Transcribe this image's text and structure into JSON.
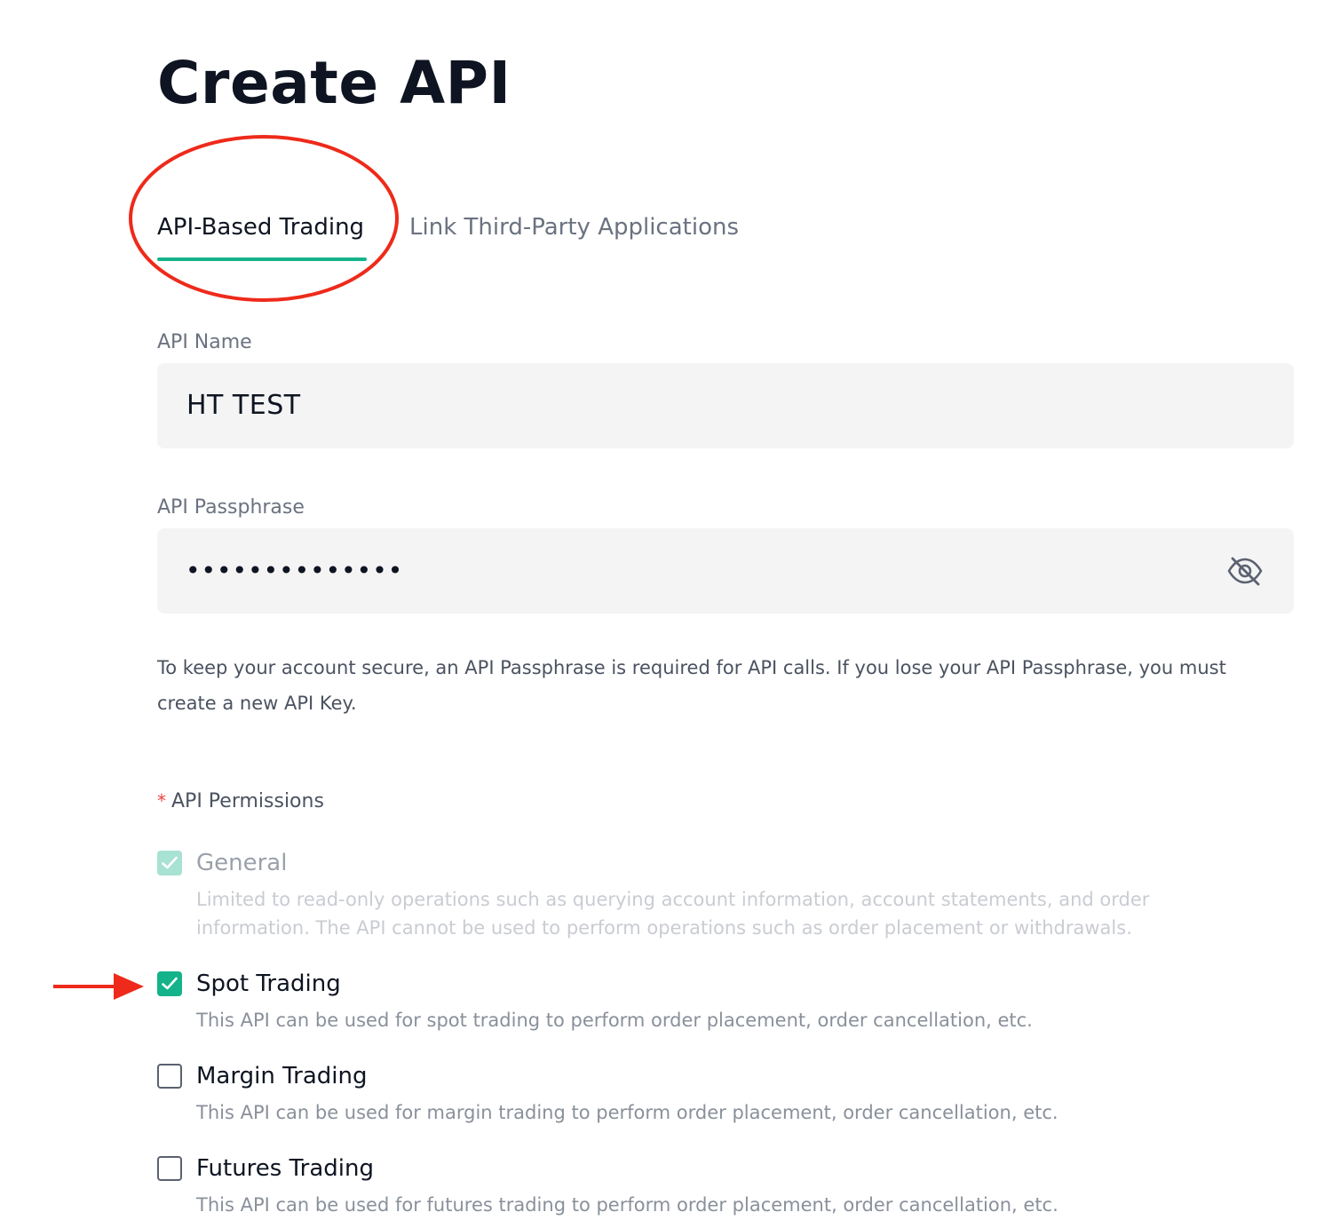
{
  "page": {
    "title": "Create API"
  },
  "tabs": [
    {
      "label": "API-Based Trading",
      "active": true
    },
    {
      "label": "Link Third-Party Applications",
      "active": false
    }
  ],
  "form": {
    "api_name": {
      "label": "API Name",
      "value": "HT TEST"
    },
    "api_passphrase": {
      "label": "API Passphrase",
      "value": "••••••••••••••",
      "visibility_icon": "eye-off-icon"
    },
    "hint": "To keep your account secure, an API Passphrase is required for API calls. If you lose your API Passphrase, you must create a new API Key."
  },
  "permissions": {
    "title": "API Permissions",
    "required_mark": "*",
    "items": [
      {
        "name": "General",
        "checked": true,
        "disabled": true,
        "description": "Limited to read-only operations such as querying account information, account statements, and order information. The API cannot be used to perform operations such as order placement or withdrawals."
      },
      {
        "name": "Spot Trading",
        "checked": true,
        "disabled": false,
        "description": "This API can be used for spot trading to perform order placement, order cancellation, etc."
      },
      {
        "name": "Margin Trading",
        "checked": false,
        "disabled": false,
        "description": "This API can be used for margin trading to perform order placement, order cancellation, etc."
      },
      {
        "name": "Futures Trading",
        "checked": false,
        "disabled": false,
        "description": "This API can be used for futures trading to perform order placement, order cancellation, etc."
      }
    ]
  },
  "colors": {
    "accent": "#14b38a",
    "annotation": "#ee2a1b",
    "required": "#ef4444"
  }
}
